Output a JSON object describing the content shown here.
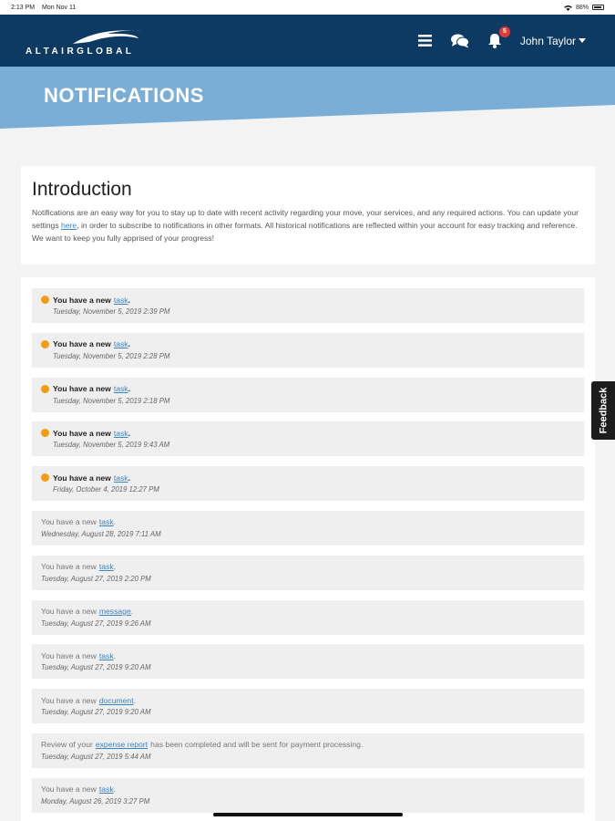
{
  "status_bar": {
    "time": "2:13 PM",
    "date": "Mon Nov 11",
    "battery": "88%"
  },
  "header": {
    "logo_text": "ALTAIRGLOBAL",
    "menu_icon": "hamburger-icon",
    "chat_icon": "chat-bubbles-icon",
    "bell_icon": "bell-icon",
    "notification_count": "5",
    "user_name": "John Taylor"
  },
  "banner": {
    "title": "NOTIFICATIONS"
  },
  "intro": {
    "title": "Introduction",
    "text_before_link": "Notifications are an easy way for you to stay up to date with recent activity regarding your move, your services, and any required actions. You can update your settings ",
    "link_text": "here",
    "text_after_link": ", in order to subscribe to notifications in other formats. All historical notifications are reflected within your account for easy tracking and reference. We want to keep you fully apprised of your progress!"
  },
  "notifications": [
    {
      "prefix": "You have a new",
      "link": "task",
      "suffix": ".",
      "date": "Tuesday, November 5, 2019 2:39 PM",
      "unread": true
    },
    {
      "prefix": "You have a new",
      "link": "task",
      "suffix": ".",
      "date": "Tuesday, November 5, 2019 2:28 PM",
      "unread": true
    },
    {
      "prefix": "You have a new",
      "link": "task",
      "suffix": ".",
      "date": "Tuesday, November 5, 2019 2:18 PM",
      "unread": true
    },
    {
      "prefix": "You have a new",
      "link": "task",
      "suffix": ".",
      "date": "Tuesday, November 5, 2019 9:43 AM",
      "unread": true
    },
    {
      "prefix": "You have a new",
      "link": "task",
      "suffix": ".",
      "date": "Friday, October 4, 2019 12:27 PM",
      "unread": true
    },
    {
      "prefix": "You have a new",
      "link": "task",
      "suffix": ".",
      "date": "Wednesday, August 28, 2019 7:11 AM",
      "unread": false
    },
    {
      "prefix": "You have a new",
      "link": "task",
      "suffix": ".",
      "date": "Tuesday, August 27, 2019 2:20 PM",
      "unread": false
    },
    {
      "prefix": "You have a new",
      "link": "message",
      "suffix": ".",
      "date": "Tuesday, August 27, 2019 9:26 AM",
      "unread": false
    },
    {
      "prefix": "You have a new",
      "link": "task",
      "suffix": ".",
      "date": "Tuesday, August 27, 2019 9:20 AM",
      "unread": false
    },
    {
      "prefix": "You have a new",
      "link": "document",
      "suffix": ".",
      "date": "Tuesday, August 27, 2019 9:20 AM",
      "unread": false
    },
    {
      "prefix": "Review of your",
      "link": "expense report",
      "suffix": "has been completed and will be sent for payment processing.",
      "date": "Tuesday, August 27, 2019 5:44 AM",
      "unread": false
    },
    {
      "prefix": "You have a new",
      "link": "task",
      "suffix": ".",
      "date": "Monday, August 26, 2019 3:27 PM",
      "unread": false
    }
  ],
  "feedback": {
    "label": "Feedback"
  },
  "colors": {
    "header": "#0c3a62",
    "banner": "#7aaed6",
    "unread_dot": "#f39c12",
    "link": "#3b84c4",
    "badge": "#e53935"
  }
}
